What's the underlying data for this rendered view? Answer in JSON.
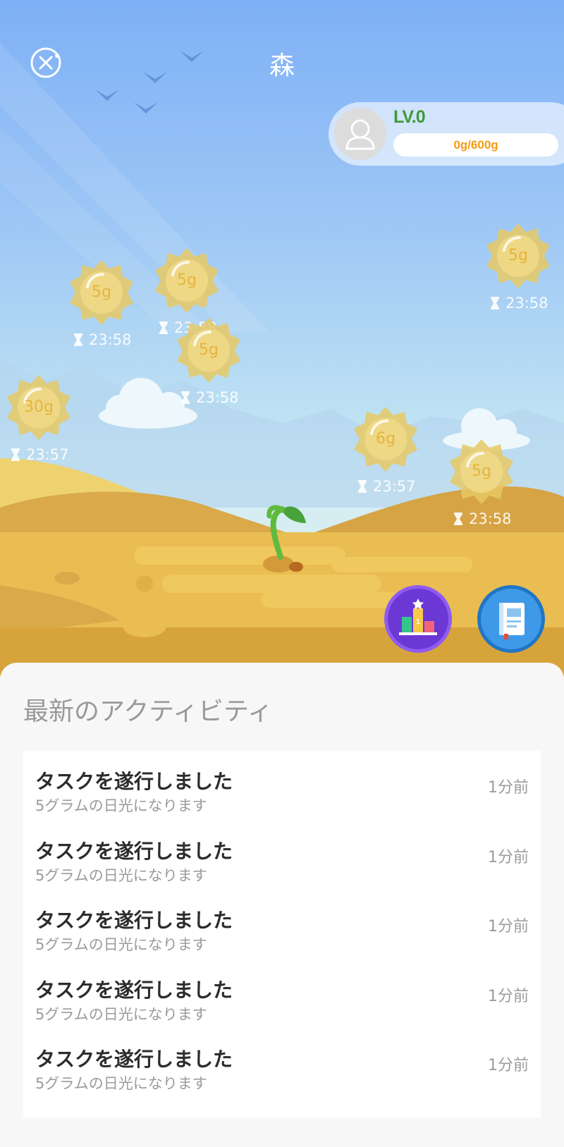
{
  "header": {
    "title": "森"
  },
  "profile": {
    "level": "LV.0",
    "progress_text": "0g/600g",
    "progress_fraction": 0
  },
  "suns": [
    {
      "amount": "5g",
      "timer": "23:58"
    },
    {
      "amount": "5g",
      "timer": "23:58"
    },
    {
      "amount": "5g",
      "timer": "23:58"
    },
    {
      "amount": "5g",
      "timer": "23:58"
    },
    {
      "amount": "30g",
      "timer": "23:57"
    },
    {
      "amount": "6g",
      "timer": "23:57"
    },
    {
      "amount": "5g",
      "timer": "23:58"
    }
  ],
  "activity": {
    "title": "最新のアクティビティ",
    "items": [
      {
        "title": "タスクを遂行しました",
        "subtitle": "5グラムの日光になります",
        "time": "1分前"
      },
      {
        "title": "タスクを遂行しました",
        "subtitle": "5グラムの日光になります",
        "time": "1分前"
      },
      {
        "title": "タスクを遂行しました",
        "subtitle": "5グラムの日光になります",
        "time": "1分前"
      },
      {
        "title": "タスクを遂行しました",
        "subtitle": "5グラムの日光になります",
        "time": "1分前"
      },
      {
        "title": "タスクを遂行しました",
        "subtitle": "5グラムの日光になります",
        "time": "1分前"
      }
    ]
  },
  "colors": {
    "level_green": "#3f9a3a",
    "progress_orange": "#f39c12",
    "sun_gold": "#e6c964",
    "sky": "#7eb0f6",
    "sand": "#e9bd52"
  }
}
